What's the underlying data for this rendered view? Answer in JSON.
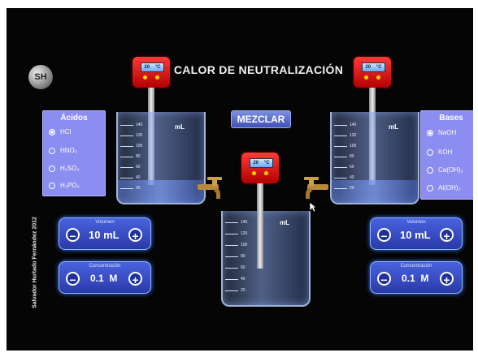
{
  "title": "CALOR DE NEUTRALIZACIÓN",
  "logo": "SH",
  "mix_button": "MEZCLAR",
  "author": "Salvador Hurtado Fernández 2012",
  "acids": {
    "title": "Ácidos",
    "options": [
      "HCl",
      "HNO₃",
      "H₂SO₄",
      "H₃PO₄"
    ],
    "selected": "HCl"
  },
  "bases": {
    "title": "Bases",
    "options": [
      "NaOH",
      "KOH",
      "Ca(OH)₂",
      "Al(OH)₃"
    ],
    "selected": "NaOH"
  },
  "left_controls": {
    "volume": {
      "label": "Volumen",
      "value": "10",
      "unit": "mL"
    },
    "concentration": {
      "label": "Concentración",
      "value": "0.1",
      "unit": "M"
    }
  },
  "right_controls": {
    "volume": {
      "label": "Volumen",
      "value": "10",
      "unit": "mL"
    },
    "concentration": {
      "label": "Concentración",
      "value": "0.1",
      "unit": "M"
    }
  },
  "thermometers": {
    "left": {
      "value": "20",
      "unit": "°C"
    },
    "center": {
      "value": "20",
      "unit": "°C"
    },
    "right": {
      "value": "20",
      "unit": "°C"
    }
  },
  "beakers": {
    "unit": "mL",
    "scale": [
      "140",
      "120",
      "100",
      "80",
      "60",
      "40",
      "20"
    ]
  },
  "colors": {
    "panel": "#8c8df0",
    "control": "#3a4fd0",
    "thermometer": "#e01010",
    "background": "#050505"
  },
  "icons": {
    "minus": "−",
    "plus": "+"
  }
}
